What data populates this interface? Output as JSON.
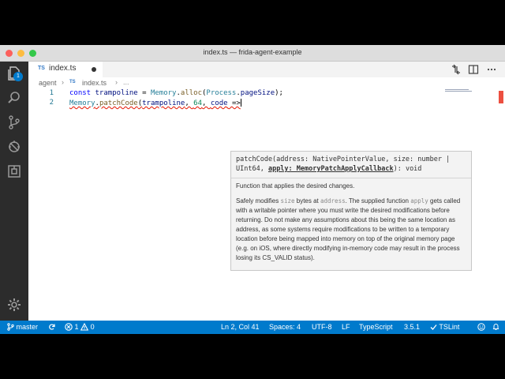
{
  "window": {
    "title": "index.ts — frida-agent-example"
  },
  "activity": {
    "explorer_badge": "1"
  },
  "tab": {
    "lang": "TS",
    "label": "index.ts"
  },
  "breadcrumb": {
    "folder": "agent",
    "sep": "›",
    "lang": "TS",
    "file": "index.ts",
    "more": "..."
  },
  "editor": {
    "line_numbers": [
      "1",
      "2"
    ],
    "line1": {
      "kw": "const",
      "var": "trampoline",
      "eq": " = ",
      "obj": "Memory",
      "dot1": ".",
      "fn": "alloc",
      "open": "(",
      "obj2": "Process",
      "dot2": ".",
      "prop": "pageSize",
      "close": ");"
    },
    "line2": {
      "obj": "Memory",
      "dot": ".",
      "fn": "patchCode",
      "open": "(",
      "arg1": "trampoline",
      "comma1": ", ",
      "arg2": "64",
      "comma2": ", ",
      "arg3": "code",
      "arrow": " =>"
    }
  },
  "hover": {
    "sig_part1": "patchCode(address: NativePointerValue, size: number | UInt64, ",
    "sig_strong": "apply: MemoryPatchApplyCallback",
    "sig_part2": "): void",
    "summary": "Function that applies the desired changes.",
    "d1": "Safely modifies ",
    "c1": "size",
    "d2": " bytes at ",
    "c2": "address",
    "d3": ". The supplied function ",
    "c3": "apply",
    "d4": " gets called with a writable pointer where you must write the desired modifications before returning. Do not make any assumptions about this being the same location as address, as some systems require modifications to be written to a temporary location before being mapped into memory on top of the original memory page (e.g. on iOS, where directly modifying in-memory code may result in the process losing its CS_VALID status)."
  },
  "status": {
    "branch": "master",
    "errors": "1",
    "warnings": "0",
    "position": "Ln 2, Col 41",
    "spaces": "Spaces: 4",
    "encoding": "UTF-8",
    "eol": "LF",
    "language": "TypeScript",
    "version": "3.5.1",
    "linter": "TSLint"
  },
  "colors": {
    "statusbar": "#007acc",
    "activitybar": "#2c2c2c",
    "error": "#e51400"
  },
  "icons": [
    "files-icon",
    "search-icon",
    "source-control-icon",
    "debug-icon",
    "extensions-icon",
    "settings-gear-icon",
    "compare-changes-icon",
    "split-editor-icon",
    "more-actions-icon",
    "git-branch-icon",
    "sync-icon",
    "error-icon",
    "warning-icon",
    "smiley-icon",
    "bell-icon"
  ]
}
